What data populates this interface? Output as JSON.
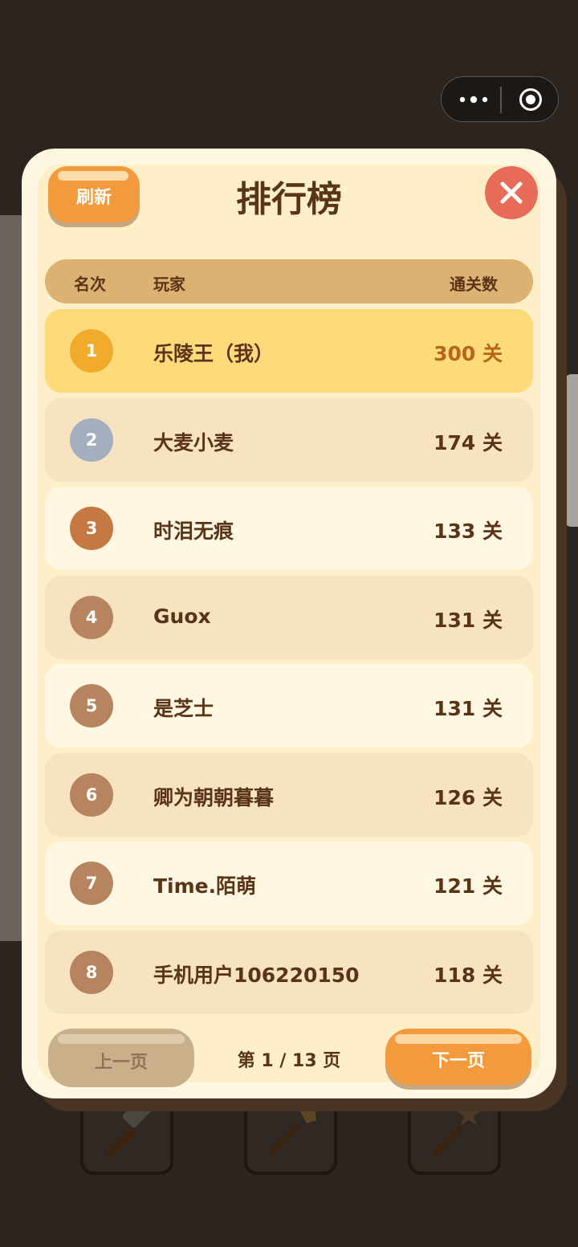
{
  "capsule": {
    "more_icon": "more-dots-icon",
    "close_icon": "target-circle-icon"
  },
  "leaderboard": {
    "title": "排行榜",
    "refresh_label": "刷新",
    "close_icon": "close-x-icon",
    "columns": {
      "rank": "名次",
      "player": "玩家",
      "levels": "通关数"
    },
    "rows": [
      {
        "rank": "1",
        "name": "乐陵王（我）",
        "score": "300 关",
        "badge_color": "#f2aa2c"
      },
      {
        "rank": "2",
        "name": "大麦小麦",
        "score": "174 关",
        "badge_color": "#a4afbd"
      },
      {
        "rank": "3",
        "name": "时泪无痕",
        "score": "133 关",
        "badge_color": "#c57842"
      },
      {
        "rank": "4",
        "name": "Guox",
        "score": "131 关",
        "badge_color": "#b6845e"
      },
      {
        "rank": "5",
        "name": "是芝士",
        "score": "131 关",
        "badge_color": "#b6845e"
      },
      {
        "rank": "6",
        "name": "卿为朝朝暮暮",
        "score": "126 关",
        "badge_color": "#b6845e"
      },
      {
        "rank": "7",
        "name": "Time.陌萌",
        "score": "121 关",
        "badge_color": "#b6845e"
      },
      {
        "rank": "8",
        "name": "手机用户106220150",
        "score": "118 关",
        "badge_color": "#b6845e"
      }
    ],
    "prev_label": "上一页",
    "page_info": "第 1 / 13 页",
    "next_label": "下一页"
  },
  "tools": [
    {
      "icon": "hammer-icon"
    },
    {
      "icon": "broom-icon"
    },
    {
      "icon": "star-wand-icon"
    }
  ],
  "colors": {
    "accent": "#f39a3d",
    "brown_text": "#5a3418",
    "close_red": "#e86a58"
  }
}
